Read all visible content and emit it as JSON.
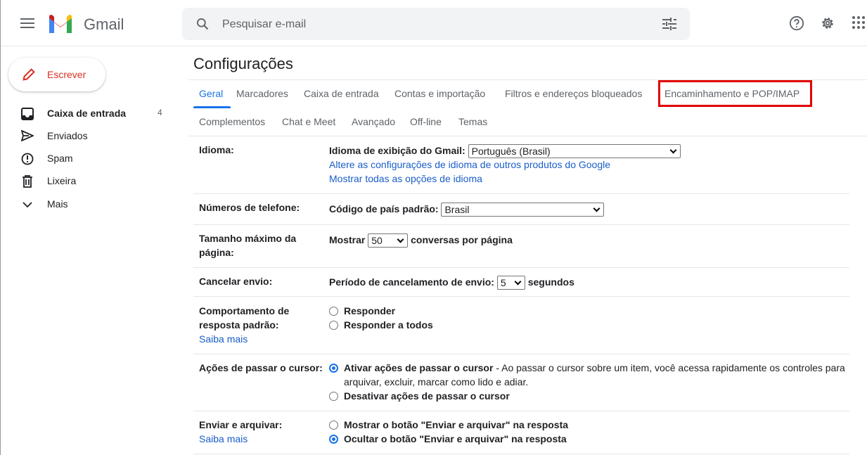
{
  "header": {
    "brand": "Gmail",
    "search_placeholder": "Pesquisar e-mail"
  },
  "sidebar": {
    "compose": "Escrever",
    "items": [
      {
        "label": "Caixa de entrada",
        "count": "4",
        "icon": "inbox-icon"
      },
      {
        "label": "Enviados",
        "icon": "send-icon"
      },
      {
        "label": "Spam",
        "icon": "spam-icon"
      },
      {
        "label": "Lixeira",
        "icon": "trash-icon"
      },
      {
        "label": "Mais",
        "icon": "chevron-down-icon"
      }
    ]
  },
  "main": {
    "title": "Configurações",
    "tabs": [
      "Geral",
      "Marcadores",
      "Caixa de entrada",
      "Contas e importação",
      "Filtros e endereços bloqueados",
      "Encaminhamento e POP/IMAP",
      "Complementos",
      "Chat e Meet",
      "Avançado",
      "Off-line",
      "Temas"
    ],
    "active_tab": "Geral",
    "highlighted_tab": "Encaminhamento e POP/IMAP",
    "highlight_color": "#e00000",
    "settings": {
      "idioma": {
        "label": "Idioma:",
        "prefix": "Idioma de exibição do Gmail:",
        "value": "Português (Brasil)",
        "link1": "Altere as configurações de idioma de outros produtos do Google",
        "link2": "Mostrar todas as opções de idioma"
      },
      "telefone": {
        "label": "Números de telefone:",
        "prefix": "Código de país padrão:",
        "value": "Brasil"
      },
      "tamanho": {
        "label": "Tamanho máximo da página:",
        "prefix": "Mostrar",
        "value": "50",
        "suffix": "conversas por página"
      },
      "cancelar": {
        "label": "Cancelar envio:",
        "prefix": "Período de cancelamento de envio:",
        "value": "5",
        "suffix": "segundos"
      },
      "resposta": {
        "label": "Comportamento de resposta padrão:",
        "link": "Saiba mais",
        "opt1": "Responder",
        "opt2": "Responder a todos"
      },
      "cursor": {
        "label": "Ações de passar o cursor:",
        "opt1": "Ativar ações de passar o cursor",
        "opt1_desc": " - Ao passar o cursor sobre um item, você acessa rapidamente os controles para",
        "opt1_desc2": "arquivar, excluir, marcar como lido e adiar.",
        "opt2": "Desativar ações de passar o cursor"
      },
      "arquivar": {
        "label": "Enviar e arquivar:",
        "link": "Saiba mais",
        "opt1": "Mostrar o botão \"Enviar e arquivar\" na resposta",
        "opt2": "Ocultar o botão \"Enviar e arquivar\" na resposta"
      }
    }
  }
}
